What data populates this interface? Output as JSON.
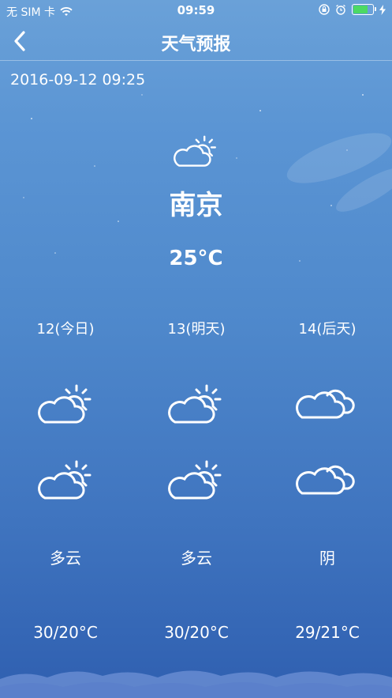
{
  "status_bar": {
    "carrier": "无 SIM 卡",
    "time": "09:59",
    "battery_level": 0.8,
    "icons": [
      "wifi-icon",
      "orientation-lock-icon",
      "alarm-icon",
      "battery-icon",
      "charging-icon"
    ]
  },
  "nav": {
    "back_icon": "chevron-left-icon",
    "title": "天气预报"
  },
  "update_time": "2016-09-12 09:25",
  "current": {
    "icon": "partly-cloudy-icon",
    "city": "南京",
    "temp": "25°C"
  },
  "forecast": [
    {
      "day": "12(今日)",
      "icon_day": "partly-cloudy-icon",
      "icon_night": "partly-cloudy-icon",
      "condition": "多云",
      "range": "30/20°C"
    },
    {
      "day": "13(明天)",
      "icon_day": "partly-cloudy-icon",
      "icon_night": "partly-cloudy-icon",
      "condition": "多云",
      "range": "30/20°C"
    },
    {
      "day": "14(后天)",
      "icon_day": "overcast-icon",
      "icon_night": "overcast-icon",
      "condition": "阴",
      "range": "29/21°C"
    }
  ],
  "colors": {
    "background_top": "#6aa1d8",
    "background_bottom": "#2f5fb0",
    "battery_fill": "#4cd964"
  }
}
